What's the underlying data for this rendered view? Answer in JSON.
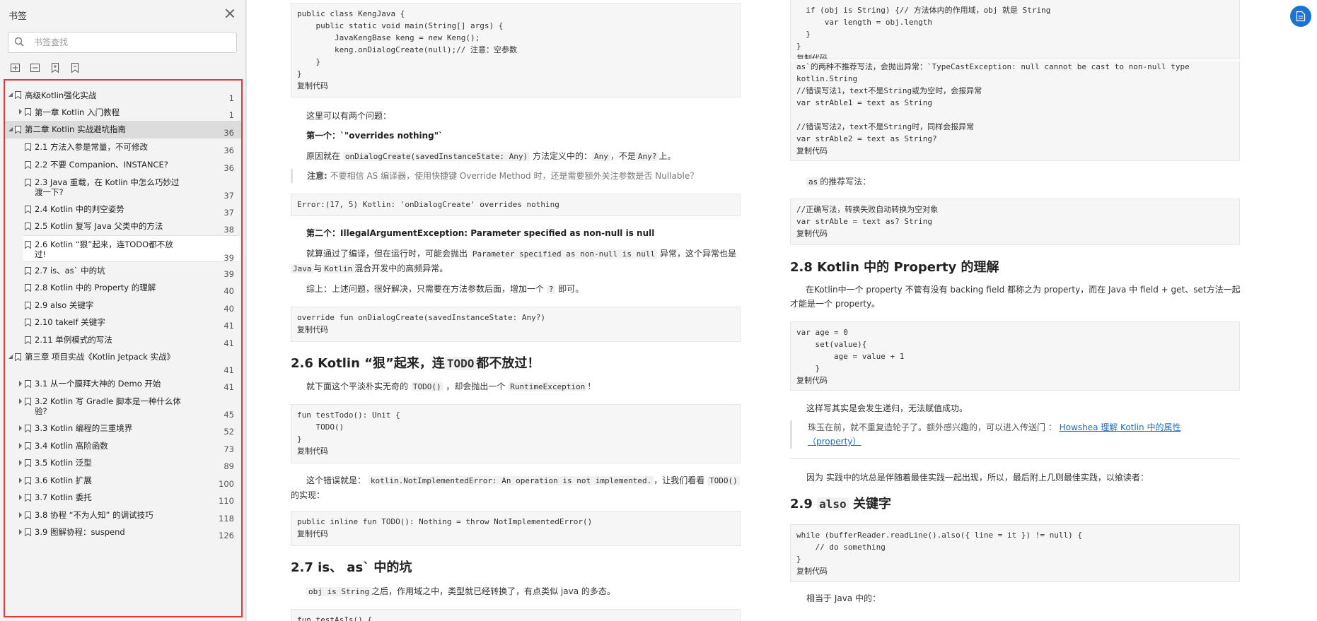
{
  "sidebar": {
    "title": "书签",
    "search_placeholder": "书签查找",
    "toc": [
      {
        "label": "高级Kotlin强化实战",
        "page": "1"
      },
      {
        "label": "第一章 Kotlin 入门教程",
        "page": "1"
      },
      {
        "label": "第二章 Kotlin 实战避坑指南",
        "page": "36"
      },
      {
        "label": "2.1 方法入参是常量，不可修改",
        "page": "36"
      },
      {
        "label": "2.2 不要 Companion、INSTANCE?",
        "page": "36"
      },
      {
        "label": "2.3 Java 重载，在 Kotlin 中怎么巧妙过渡一下?",
        "page": "37"
      },
      {
        "label": "2.4 Kotlin 中的判空姿势",
        "page": "37"
      },
      {
        "label": "2.5 Kotlin 复写 Java 父类中的方法",
        "page": "38"
      },
      {
        "label": "2.6 Kotlin “狠”起来，连TODO都不放过!",
        "page": "39"
      },
      {
        "label": "2.7 is、as` 中的坑",
        "page": "39"
      },
      {
        "label": "2.8 Kotlin 中的 Property 的理解",
        "page": "40"
      },
      {
        "label": "2.9 also 关键字",
        "page": "40"
      },
      {
        "label": "2.10 takeIf 关键字",
        "page": "41"
      },
      {
        "label": "2.11 单例模式的写法",
        "page": "41"
      },
      {
        "label": "第三章 项目实战《Kotlin Jetpack 实战》",
        "page": "41"
      },
      {
        "label": "3.1 从一个膜拜大神的 Demo 开始",
        "page": "41"
      },
      {
        "label": "3.2 Kotlin 写 Gradle 脚本是一种什么体验?",
        "page": "45"
      },
      {
        "label": "3.3 Kotlin 编程的三重境界",
        "page": "52"
      },
      {
        "label": "3.4  Kotlin 高阶函数",
        "page": "73"
      },
      {
        "label": "3.5 Kotlin 泛型",
        "page": "89"
      },
      {
        "label": "3.6 Kotlin 扩展",
        "page": "100"
      },
      {
        "label": "3.7 Kotlin 委托",
        "page": "110"
      },
      {
        "label": "3.8 协程 “不为人知” 的调试技巧",
        "page": "118"
      },
      {
        "label": "3.9 图解协程：suspend",
        "page": "126"
      }
    ]
  },
  "left_page": {
    "code1": "public class KengJava {\n    public static void main(String[] args) {\n        JavaKengBase keng = new Keng();\n        keng.onDialogCreate(null);// 注意：空参数\n    }\n}",
    "copy": "复制代码",
    "p1": "这里可以有两个问题：",
    "p2": "第一个：`\"overrides nothing\"`",
    "p3_a": "原因就在",
    "p3_c1": "onDialogCreate(savedInstanceState: Any)",
    "p3_b": "方法定义中的：",
    "p3_c2": "Any",
    "p3_c": "，不是",
    "p3_c3": "Any?",
    "p3_d": "上。",
    "quote1_strong": "注意:",
    "quote1_text": "不要相信 AS 编译器，使用快捷键 Override Method 时，还是需要额外关注参数是否 Nullable？",
    "code2": "Error:(17, 5) Kotlin: 'onDialogCreate' overrides nothing",
    "p4": "第二个：IllegalArgumentException: Parameter specified as non-null is null",
    "p5_a": "就算通过了编译，但在运行时，可能会抛出",
    "p5_c1": "Parameter specified as non-null is null",
    "p5_b": "异常，这个异常也是",
    "p5_c2": "Java",
    "p5_c": "与",
    "p5_c3": "Kotlin",
    "p5_d": "混合开发中的高频异常。",
    "p6_a": "综上：上述问题，很好解决，只需要在方法参数后面，增加一个",
    "p6_c1": "?",
    "p6_b": "即可。",
    "code3": "override fun onDialogCreate(savedInstanceState: Any?)",
    "h26_a": "2.6 Kotlin “狠”起来，连",
    "h26_code": "TODO",
    "h26_b": "都不放过！",
    "p7_a": "就下面这个平淡朴实无奇的",
    "p7_c1": "TODO()",
    "p7_b": "，却会抛出一个",
    "p7_c2": "RuntimeException",
    "p7_c": "！",
    "code4": "fun testTodo(): Unit {\n    TODO()\n}",
    "p8_a": "这个错误就是：",
    "p8_c1": "kotlin.NotImplementedError: An operation is not implemented.",
    "p8_b": "，让我们看看",
    "p8_c2": "TODO()",
    "p8_c": "的实现：",
    "code5": "public inline fun TODO(): Nothing = throw NotImplementedError()",
    "h27": "2.7 is、 as` 中的坑",
    "p9_c1": "obj is String",
    "p9_a": "之后，作用域之中，类型就已经转换了，有点类似 java 的多态。",
    "code6": "fun testAsIs() {"
  },
  "right_page": {
    "code1": "  if (obj is String) {// 方法体内的作用域，obj 就是 String\n      var length = obj.length\n  }\n}",
    "copy": "复制代码",
    "text1": "as`的两种不推荐写法，会抛出异常：`TypeCastException: null cannot be cast to non-null type\nkotlin.String\n//错误写法1，text不是String或为空时，会报异常\nvar strAble1 = text as String\n\n//错误写法2，text不是String时，同样会报异常\nvar strAble2 = text as String?",
    "p1_c": "as",
    "p1": "的推荐写法：",
    "code2": "//正确写法，转换失败自动转换为空对象\nvar strAble = text as? String",
    "h28": "2.8 Kotlin 中的 Property 的理解",
    "p2": "在Kotlin中一个 property 不管有没有 backing field 都称之为 property，而在 Java 中 field + get、set方法一起才能是一个 property。",
    "code3": "var age = 0\n    set(value){\n        age = value + 1\n    }",
    "p3": "这样写其实是会发生递归，无法赋值成功。",
    "quote_text": "珠玉在前，就不重复造轮子了。额外感兴趣的，可以进入传送门 ：",
    "quote_link": "Howshea 理解 Kotlin 中的属性（property）",
    "p4": "因为 实践中的坑总是伴随着最佳实践一起出现，所以，最后附上几则最佳实践，以飨读者：",
    "h29_a": "2.9 ",
    "h29_code": "also",
    "h29_b": " 关键字",
    "code4": "while (bufferReader.readLine().also({ line = it }) != null) {\n    // do something\n}",
    "p5": "相当于 Java 中的："
  },
  "colors": {
    "accent": "#1e73d1",
    "highlight_border": "#e53935"
  }
}
